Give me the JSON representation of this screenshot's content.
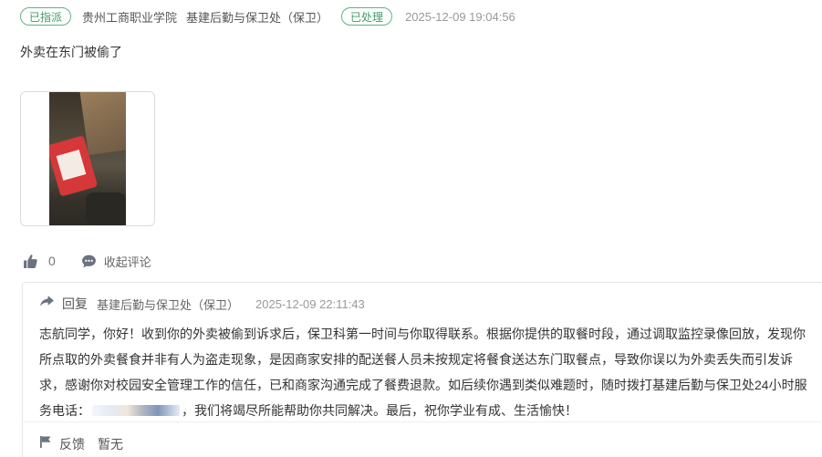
{
  "header": {
    "status_assigned": "已指派",
    "org": "贵州工商职业学院",
    "department": "基建后勤与保卫处（保卫）",
    "status_processed": "已处理",
    "timestamp": "2025-12-09 19:04:56"
  },
  "post": {
    "title": "外卖在东门被偷了",
    "image_icon": "photo-thumbnail"
  },
  "actions": {
    "like_icon": "thumbs-up-icon",
    "like_count": "0",
    "comment_icon": "chat-bubble-icon",
    "comment_label": "收起评论"
  },
  "reply": {
    "icon": "reply-arrow-icon",
    "label": "回复",
    "author": "基建后勤与保卫处（保卫）",
    "timestamp": "2025-12-09 22:11:43",
    "body_part1": "志航同学，你好！收到你的外卖被偷到诉求后，保卫科第一时间与你取得联系。根据你提供的取餐时段，通过调取监控录像回放，发现你所点取的外卖餐食并非有人为盗走现象，是因商家安排的配送餐人员未按规定将餐食送达东门取餐点，导致你误以为外卖丢失而引发诉求，感谢你对校园安全管理工作的信任，已和商家沟通完成了餐费退款。如后续你遇到类似难题时，随时拨打基建后勤与保卫处24小时服务电话：",
    "body_part2": "，我们将竭尽所能帮助你共同解决。最后，祝你学业有成、生活愉快！"
  },
  "feedback": {
    "icon": "flag-icon",
    "label": "反馈",
    "value": "暂无"
  },
  "colors": {
    "tag_border": "#5fb383",
    "tag_text": "#3f9b67",
    "muted_text": "#999999"
  }
}
